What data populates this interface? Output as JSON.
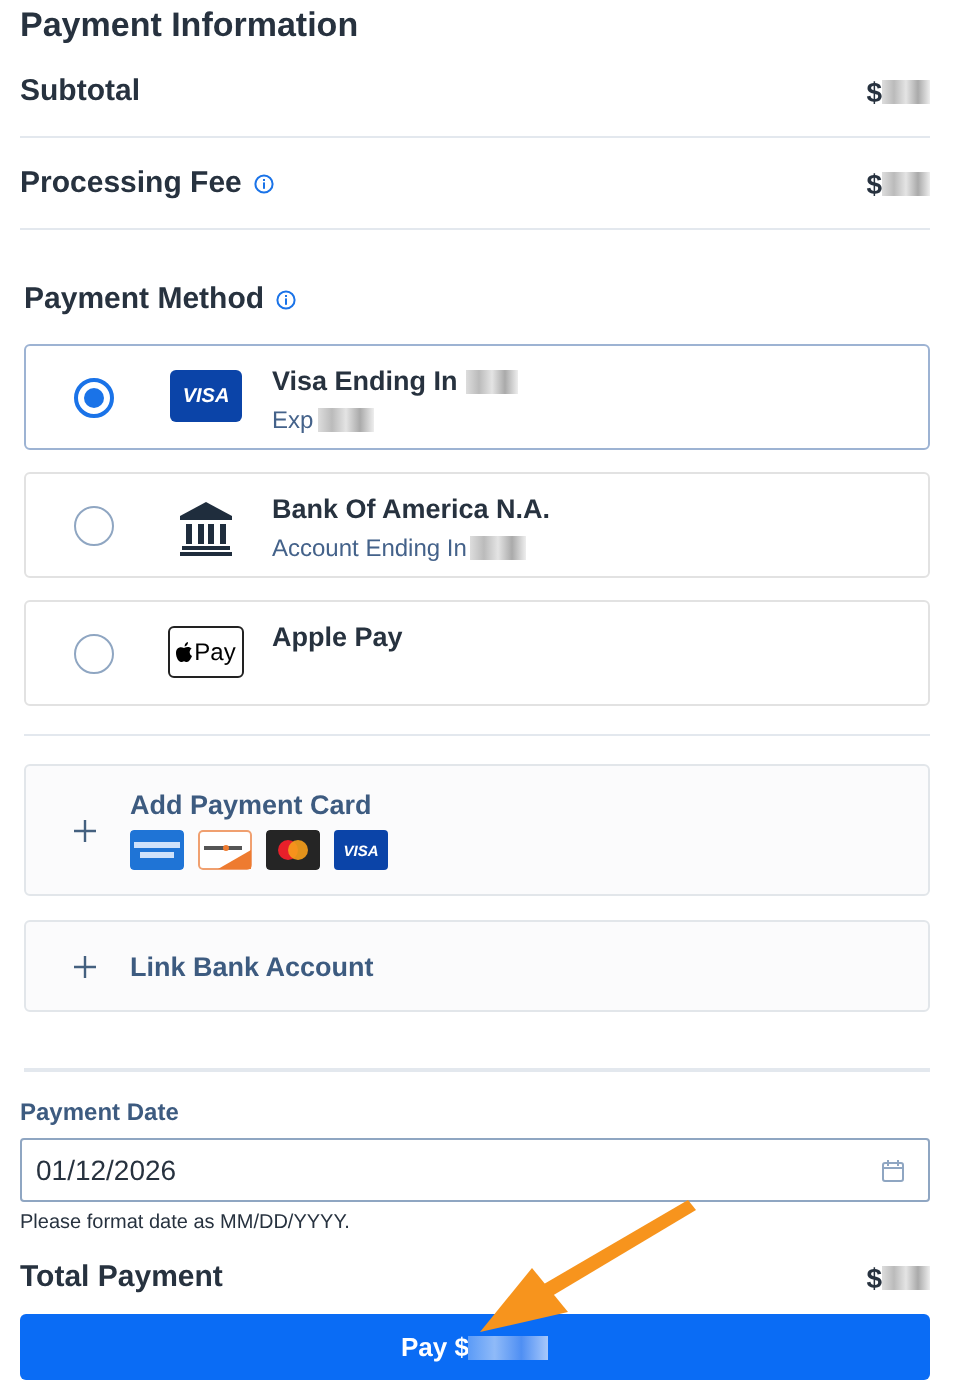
{
  "header": {
    "title": "Payment Information"
  },
  "summary": [
    {
      "label": "Subtotal",
      "info": false,
      "currency": "$"
    },
    {
      "label": "Processing Fee",
      "info": true,
      "currency": "$"
    }
  ],
  "payment_method": {
    "title": "Payment Method",
    "info": true,
    "options": [
      {
        "kind": "visa",
        "selected": true,
        "name": "Visa Ending In",
        "detail": "Exp",
        "logo_text": "VISA"
      },
      {
        "kind": "bank",
        "selected": false,
        "name": "Bank Of America N.A.",
        "detail": "Account Ending In"
      },
      {
        "kind": "applepay",
        "selected": false,
        "name": "Apple Pay",
        "logo_text": "Pay"
      }
    ]
  },
  "add_options": [
    {
      "label": "Add Payment Card",
      "card_logos": [
        {
          "kind": "amex"
        },
        {
          "kind": "discover"
        },
        {
          "kind": "mastercard"
        },
        {
          "kind": "visa",
          "text": "VISA"
        }
      ]
    },
    {
      "label": "Link Bank Account"
    }
  ],
  "payment_date": {
    "label": "Payment Date",
    "value": "01/12/2026",
    "hint": "Please format date as MM/DD/YYYY."
  },
  "total": {
    "label": "Total Payment",
    "currency": "$"
  },
  "pay_button": {
    "label": "Pay $"
  }
}
